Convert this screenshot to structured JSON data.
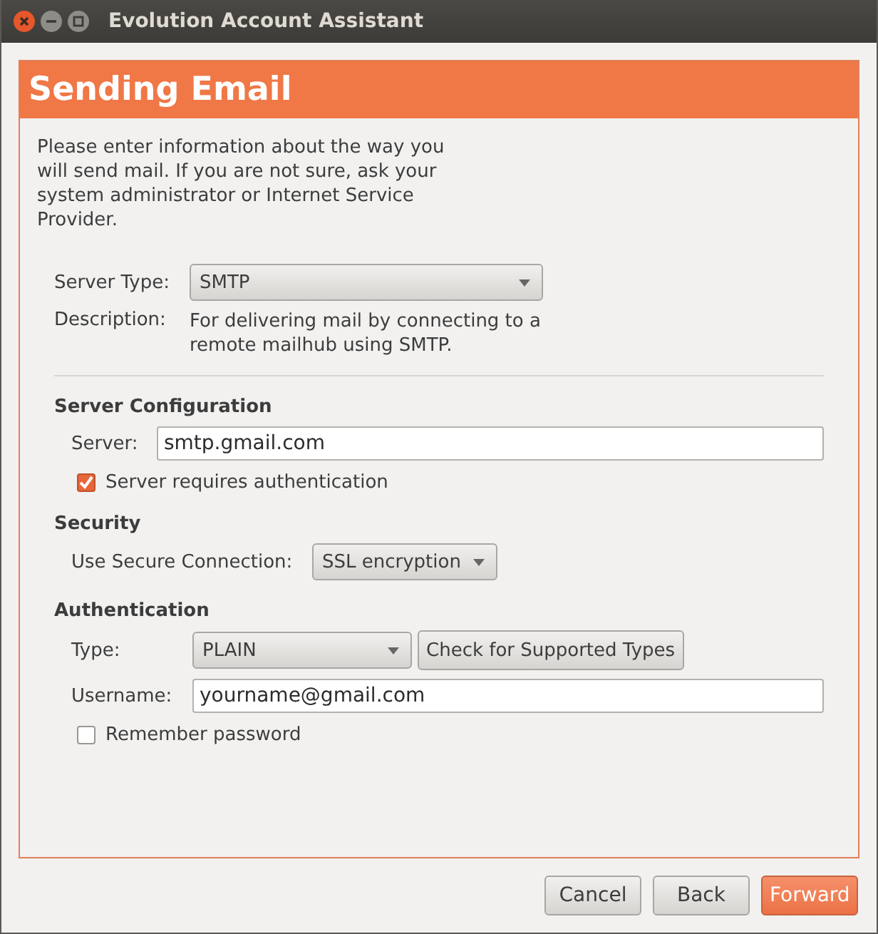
{
  "window": {
    "title": "Evolution Account Assistant"
  },
  "page": {
    "title": "Sending Email",
    "intro": "Please enter information about the way you will send mail. If you are not sure, ask your system administrator or Internet Service Provider."
  },
  "server_type": {
    "label": "Server Type:",
    "value": "SMTP"
  },
  "description": {
    "label": "Description:",
    "text": "For delivering mail by connecting to a remote mailhub using SMTP."
  },
  "server_configuration": {
    "heading": "Server Configuration",
    "server": {
      "label": "Server:",
      "value": "smtp.gmail.com"
    },
    "requires_auth": {
      "label": "Server requires authentication",
      "checked": true
    }
  },
  "security": {
    "heading": "Security",
    "connection": {
      "label": "Use Secure Connection:",
      "value": "SSL encryption"
    }
  },
  "authentication": {
    "heading": "Authentication",
    "type": {
      "label": "Type:",
      "value": "PLAIN"
    },
    "check_button": "Check for Supported Types",
    "username": {
      "label": "Username:",
      "value": "yourname@gmail.com"
    },
    "remember": {
      "label": "Remember password",
      "checked": false
    }
  },
  "buttons": [
    {
      "label": "Cancel",
      "kind": "normal"
    },
    {
      "label": "Back",
      "kind": "normal"
    },
    {
      "label": "Forward",
      "kind": "primary"
    }
  ]
}
